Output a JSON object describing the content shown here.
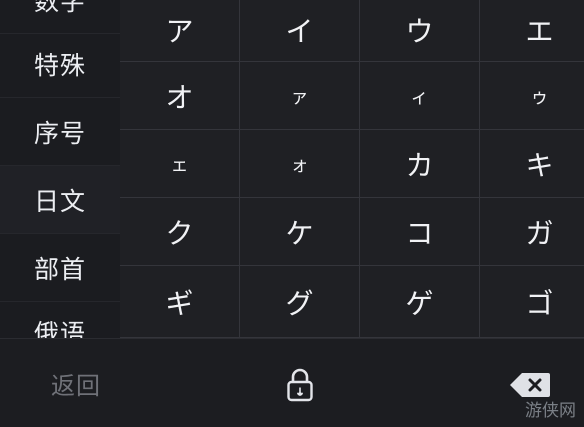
{
  "sidebar": {
    "items": [
      {
        "label": "数字",
        "active": false
      },
      {
        "label": "特殊",
        "active": false
      },
      {
        "label": "序号",
        "active": false
      },
      {
        "label": "日文",
        "active": true
      },
      {
        "label": "部首",
        "active": false
      },
      {
        "label": "俄语",
        "active": false
      }
    ]
  },
  "grid": {
    "keys": [
      "ア",
      "イ",
      "ウ",
      "エ",
      "オ",
      "ァ",
      "ィ",
      "ゥ",
      "ェ",
      "ォ",
      "カ",
      "キ",
      "ク",
      "ケ",
      "コ",
      "ガ",
      "ギ",
      "グ",
      "ゲ",
      "ゴ"
    ]
  },
  "bottom_bar": {
    "back_label": "返回",
    "lock_icon": "lock-icon",
    "delete_icon": "backspace-icon"
  },
  "watermark": "游侠网",
  "colors": {
    "background": "#1d1e22",
    "key_text": "#f1f2f5",
    "grid_line": "#34353b",
    "muted_text": "#6f7178"
  }
}
